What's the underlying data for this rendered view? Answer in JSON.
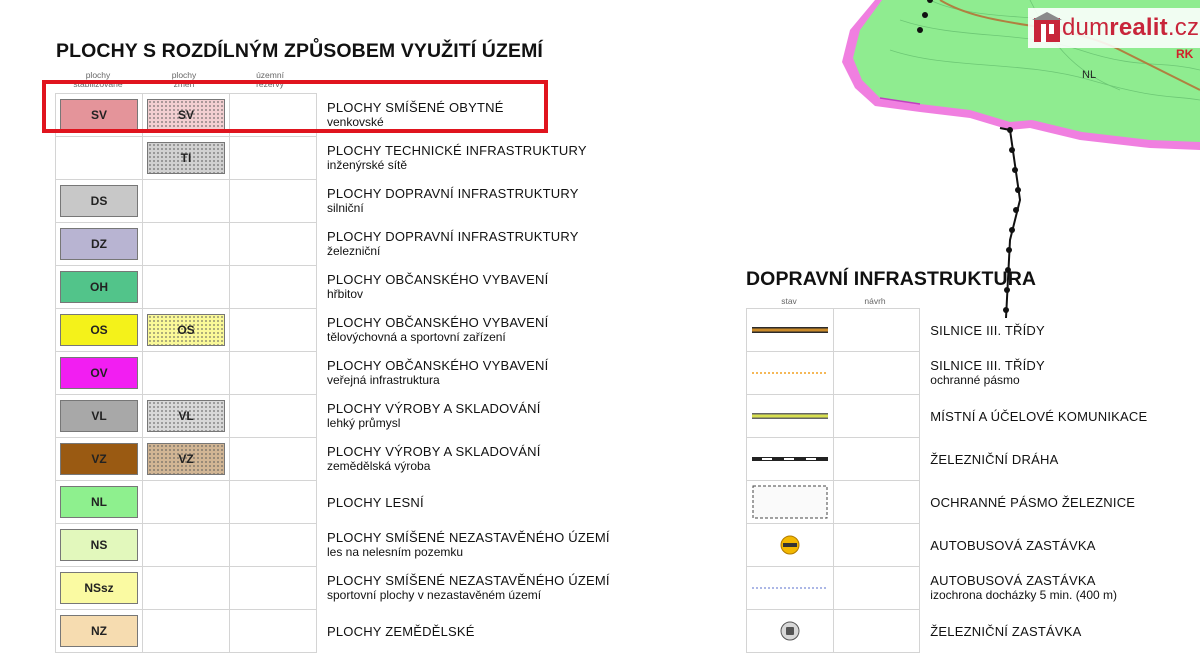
{
  "watermark": {
    "prefix": "dum",
    "suffix": "realit",
    "tld": ".cz"
  },
  "map": {
    "label": "NL",
    "corner_label": "RK"
  },
  "left": {
    "title": "PLOCHY S ROZDÍLNÝM ZPŮSOBEM VYUŽITÍ ÚZEMÍ",
    "col_headers": [
      {
        "line1": "plochy",
        "line2": "stabilizované"
      },
      {
        "line1": "plochy",
        "line2": "změn"
      },
      {
        "line1": "územní",
        "line2": "rezervy"
      }
    ],
    "rows": [
      {
        "code": "SV",
        "change": "SV",
        "color": "#e4949a",
        "line1": "PLOCHY SMÍŠENÉ OBYTNÉ",
        "line2": "venkovské"
      },
      {
        "code": "",
        "change": "TI",
        "color": "#9a9a9a",
        "line1": "PLOCHY TECHNICKÉ INFRASTRUKTURY",
        "line2": "inženýrské sítě"
      },
      {
        "code": "DS",
        "change": "",
        "color": "#c8c8c8",
        "line1": "PLOCHY DOPRAVNÍ INFRASTRUKTURY",
        "line2": "silniční"
      },
      {
        "code": "DZ",
        "change": "",
        "color": "#b8b4d2",
        "line1": "PLOCHY DOPRAVNÍ INFRASTRUKTURY",
        "line2": "železniční"
      },
      {
        "code": "OH",
        "change": "",
        "color": "#52c48a",
        "line1": "PLOCHY OBČANSKÉHO VYBAVENÍ",
        "line2": "hřbitov"
      },
      {
        "code": "OS",
        "change": "OS",
        "color": "#f4f21a",
        "line1": "PLOCHY OBČANSKÉHO VYBAVENÍ",
        "line2": "tělovýchovná a sportovní zařízení"
      },
      {
        "code": "OV",
        "change": "",
        "color": "#f21ef2",
        "line1": "PLOCHY OBČANSKÉHO VYBAVENÍ",
        "line2": "veřejná infrastruktura"
      },
      {
        "code": "VL",
        "change": "VL",
        "color": "#a8a8a8",
        "line1": "PLOCHY VÝROBY A SKLADOVÁNÍ",
        "line2": "lehký průmysl"
      },
      {
        "code": "VZ",
        "change": "VZ",
        "color": "#9a5a12",
        "line1": "PLOCHY VÝROBY A SKLADOVÁNÍ",
        "line2": "zemědělská výroba"
      },
      {
        "code": "NL",
        "change": "",
        "color": "#8ef08e",
        "line1": "PLOCHY LESNÍ",
        "line2": ""
      },
      {
        "code": "NS",
        "change": "",
        "color": "#e2f8bc",
        "line1": "PLOCHY SMÍŠENÉ NEZASTAVĚNÉHO ÚZEMÍ",
        "line2": "les na nelesním pozemku"
      },
      {
        "code": "NSsz",
        "change": "",
        "color": "#fafaa2",
        "line1": "PLOCHY SMÍŠENÉ NEZASTAVĚNÉHO ÚZEMÍ",
        "line2": "sportovní plochy v nezastavěném území"
      },
      {
        "code": "NZ",
        "change": "",
        "color": "#f6dcb0",
        "line1": "PLOCHY ZEMĚDĚLSKÉ",
        "line2": ""
      }
    ]
  },
  "right": {
    "title": "DOPRAVNÍ INFRASTRUKTURA",
    "col_headers": [
      "stav",
      "návrh"
    ],
    "rows": [
      {
        "symbol": "road-brown-line",
        "line1": "SILNICE III. TŘÍDY",
        "line2": ""
      },
      {
        "symbol": "dotted-orange-line",
        "line1": "SILNICE III. TŘÍDY",
        "line2": "ochranné pásmo"
      },
      {
        "symbol": "road-yellow-line",
        "line1": "MÍSTNÍ A ÚČELOVÉ KOMUNIKACE",
        "line2": ""
      },
      {
        "symbol": "railway-line",
        "line1": "ŽELEZNIČNÍ DRÁHA",
        "line2": ""
      },
      {
        "symbol": "dashed-box",
        "line1": "OCHRANNÉ PÁSMO ŽELEZNICE",
        "line2": ""
      },
      {
        "symbol": "bus-stop-icon",
        "line1": "AUTOBUSOVÁ ZASTÁVKA",
        "line2": ""
      },
      {
        "symbol": "dotted-blue-line",
        "line1": "AUTOBUSOVÁ ZASTÁVKA",
        "line2": "izochrona docházky 5 min.  (400 m)"
      },
      {
        "symbol": "train-stop-icon",
        "line1": "ŽELEZNIČNÍ ZASTÁVKA",
        "line2": ""
      }
    ]
  }
}
